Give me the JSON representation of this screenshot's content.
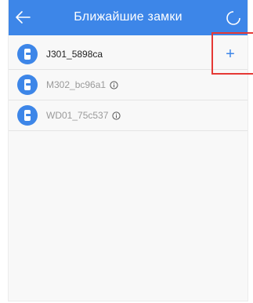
{
  "header": {
    "title": "Ближайшие замки",
    "back_icon": "arrow-left-icon",
    "refresh_icon": "refresh-ring-icon",
    "bg_color": "#3d86e8"
  },
  "locks": [
    {
      "name": "J301_5898ca",
      "state": "available",
      "action_icon": "plus-icon",
      "action_label": "+"
    },
    {
      "name": "M302_bc96a1",
      "state": "dimmed",
      "info_icon": "info-icon"
    },
    {
      "name": "WD01_75c537",
      "state": "dimmed",
      "info_icon": "info-icon"
    }
  ],
  "colors": {
    "accent": "#3d86e8",
    "highlight": "#e53935",
    "dim_text": "#9a9a9a"
  }
}
